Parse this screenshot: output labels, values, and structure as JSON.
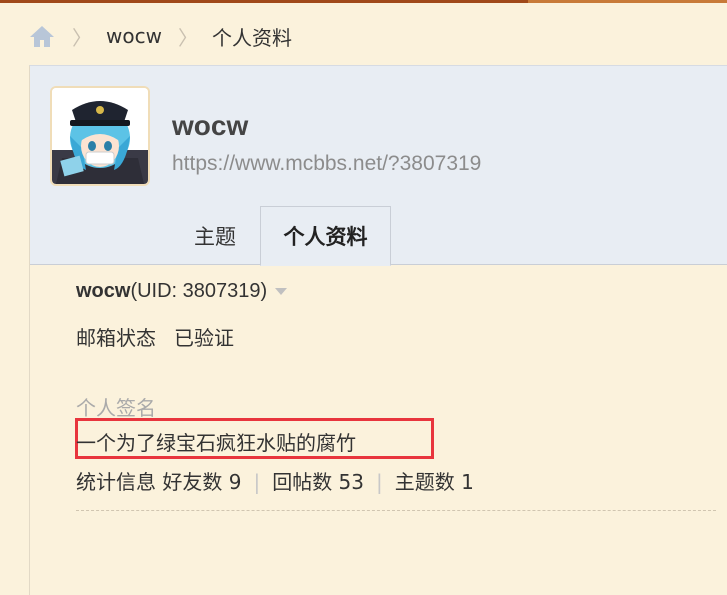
{
  "breadcrumb": {
    "home_icon": "home-icon",
    "items": [
      "wocw",
      "个人资料"
    ]
  },
  "header": {
    "username": "wocw",
    "url": "https://www.mcbbs.net/?3807319",
    "avatar_icon": "avatar-image"
  },
  "tabs": [
    {
      "label": "主题",
      "active": false
    },
    {
      "label": "个人资料",
      "active": true
    }
  ],
  "profile": {
    "name": "wocw",
    "uid": "(UID: 3807319)",
    "email_label": "邮箱状态",
    "email_value": "已验证",
    "signature_label": "个人签名",
    "signature": "一个为了绿宝石疯狂水贴的腐竹",
    "stats_label": "统计信息",
    "friends": "好友数 9",
    "replies": "回帖数 53",
    "threads": "主题数 1"
  },
  "colors": {
    "page_bg": "#fbf2dc",
    "header_bg": "#e8edf3",
    "highlight": "#e8353d",
    "top_bar": "#a0491a"
  }
}
